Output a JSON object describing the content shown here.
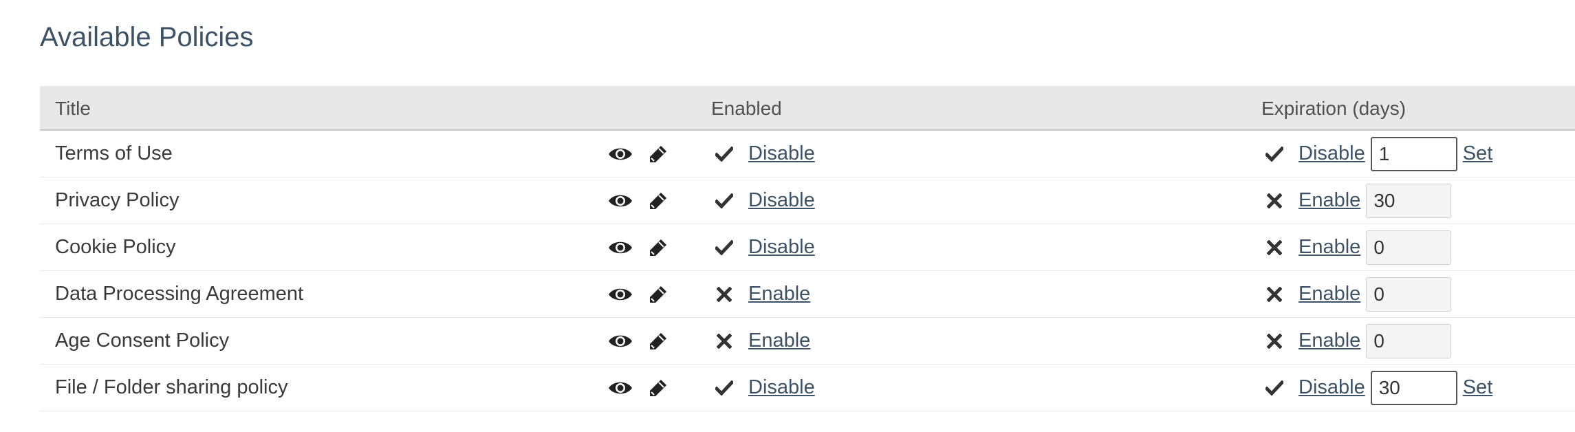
{
  "page": {
    "title": "Available Policies"
  },
  "table": {
    "headers": {
      "title": "Title",
      "enabled": "Enabled",
      "expiration": "Expiration (days)"
    },
    "rows": [
      {
        "title": "Terms of Use",
        "enabled": true,
        "enabled_action": "Disable",
        "exp_enabled": true,
        "exp_action": "Disable",
        "exp_value": "1",
        "set_label": "Set"
      },
      {
        "title": "Privacy Policy",
        "enabled": true,
        "enabled_action": "Disable",
        "exp_enabled": false,
        "exp_action": "Enable",
        "exp_value": "30",
        "set_label": ""
      },
      {
        "title": "Cookie Policy",
        "enabled": true,
        "enabled_action": "Disable",
        "exp_enabled": false,
        "exp_action": "Enable",
        "exp_value": "0",
        "set_label": ""
      },
      {
        "title": "Data Processing Agreement",
        "enabled": false,
        "enabled_action": "Enable",
        "exp_enabled": false,
        "exp_action": "Enable",
        "exp_value": "0",
        "set_label": ""
      },
      {
        "title": "Age Consent Policy",
        "enabled": false,
        "enabled_action": "Enable",
        "exp_enabled": false,
        "exp_action": "Enable",
        "exp_value": "0",
        "set_label": ""
      },
      {
        "title": "File / Folder sharing policy",
        "enabled": true,
        "enabled_action": "Disable",
        "exp_enabled": true,
        "exp_action": "Disable",
        "exp_value": "30",
        "set_label": "Set"
      }
    ]
  },
  "icons": {
    "view": "eye-icon",
    "edit": "pencil-icon",
    "on": "check-icon",
    "off": "cross-icon"
  }
}
